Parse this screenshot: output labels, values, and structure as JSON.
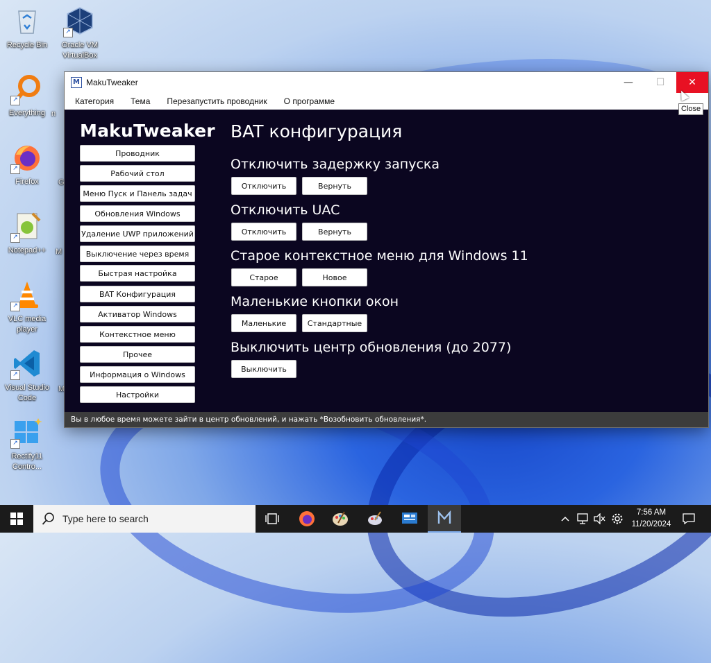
{
  "desktop": {
    "icons": [
      {
        "name": "recycle-bin",
        "label": "Recycle Bin"
      },
      {
        "name": "virtualbox",
        "label": "Oracle VM VirtualBox"
      },
      {
        "name": "everything",
        "label": "Everything"
      },
      {
        "name": "firefox",
        "label": "Firefox"
      },
      {
        "name": "notepadpp",
        "label": "Notepad++"
      },
      {
        "name": "vlc",
        "label": "VLC media player"
      },
      {
        "name": "vscode",
        "label": "Visual Studio Code"
      },
      {
        "name": "rectify11",
        "label": "Rectify11 Contro..."
      }
    ],
    "partial_labels": [
      "n",
      "G",
      "M",
      "M"
    ]
  },
  "window": {
    "title": "MakuTweaker",
    "tooltip": "Close",
    "menu": [
      "Категория",
      "Тема",
      "Перезапустить проводник",
      "О программе"
    ],
    "brand": "MakuTweaker",
    "sidebar": [
      "Проводник",
      "Рабочий стол",
      "Меню Пуск и Панель задач",
      "Обновления Windows",
      "Удаление UWP приложений",
      "Выключение через время",
      "Быстрая настройка",
      "BAT Конфигурация",
      "Активатор Windows",
      "Контекстное меню",
      "Прочее",
      "Информация о Windows",
      "Настройки"
    ],
    "page_title": "BAT конфигурация",
    "sections": [
      {
        "title": "Отключить задержку запуска",
        "buttons": [
          "Отключить",
          "Вернуть"
        ]
      },
      {
        "title": "Отключить UAC",
        "buttons": [
          "Отключить",
          "Вернуть"
        ]
      },
      {
        "title": "Старое контекстное меню для Windows 11",
        "buttons": [
          "Старое",
          "Новое"
        ]
      },
      {
        "title": "Маленькие кнопки окон",
        "buttons": [
          "Маленькие",
          "Стандартные"
        ]
      },
      {
        "title": "Выключить центр обновления (до 2077)",
        "buttons": [
          "Выключить"
        ]
      }
    ],
    "status": "Вы в любое время можете зайти в центр обновлений, и нажать *Возобновить обновления*."
  },
  "taskbar": {
    "search_placeholder": "Type here to search",
    "time": "7:56 AM",
    "date": "11/20/2024"
  },
  "colors": {
    "window_bg": "#0b0620",
    "close_red": "#e81123",
    "taskbar": "#1b1b1b"
  }
}
